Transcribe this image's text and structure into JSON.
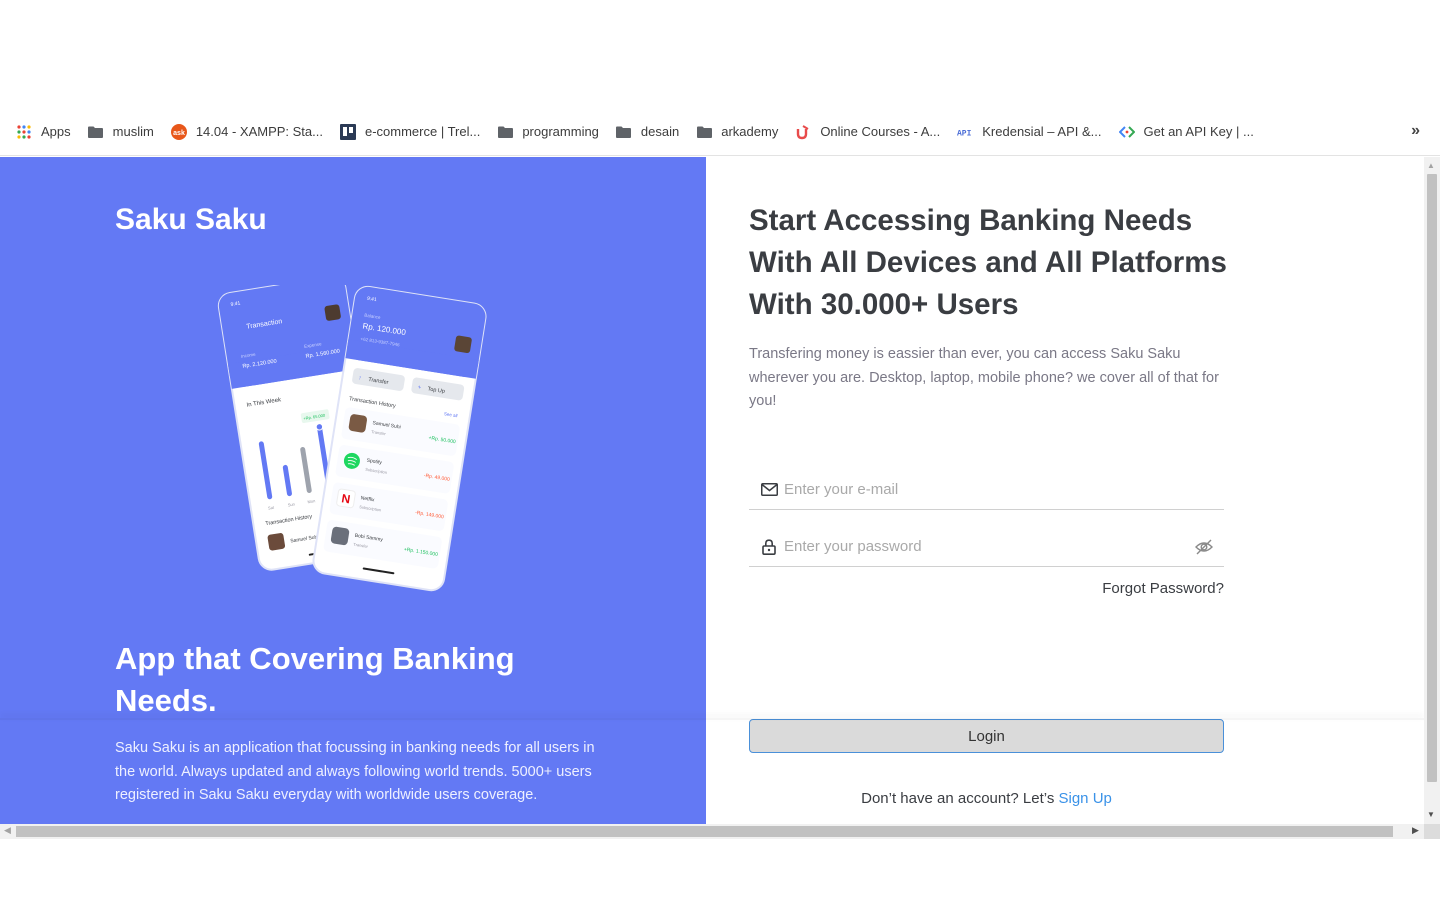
{
  "bookmarks": {
    "items": [
      {
        "label": "Apps",
        "icon": "apps-grid-icon"
      },
      {
        "label": "muslim",
        "icon": "folder-icon"
      },
      {
        "label": "14.04 - XAMPP: Sta...",
        "icon": "ask-icon"
      },
      {
        "label": "e-commerce | Trel...",
        "icon": "trello-icon"
      },
      {
        "label": "programming",
        "icon": "folder-icon"
      },
      {
        "label": "desain",
        "icon": "folder-icon"
      },
      {
        "label": "arkademy",
        "icon": "folder-icon"
      },
      {
        "label": "Online Courses - A...",
        "icon": "udemy-icon"
      },
      {
        "label": "Kredensial – API &...",
        "icon": "api-icon"
      },
      {
        "label": "Get an API Key | ...",
        "icon": "google-dev-icon"
      }
    ],
    "more": "»"
  },
  "left": {
    "brand": "Saku Saku",
    "heading": "App that Covering Banking Needs.",
    "description": "Saku Saku is an application that focussing in banking needs for all users in the world. Always updated and always following world trends. 5000+ users registered in Saku Saku everyday with worldwide users coverage."
  },
  "phone_back": {
    "title": "Transaction",
    "income_label": "Income",
    "income_value": "Rp. 2.120.000",
    "expense_label": "Expense",
    "expense_value": "Rp. 1.560.000",
    "week_label": "In This Week",
    "bar_badge": "+Rp. 65.000",
    "bar_levels": [
      0.78,
      0.42,
      0.62,
      0.85,
      0.55
    ],
    "days": [
      "Sat",
      "Sun",
      "Mon",
      "Tue"
    ],
    "history_label": "Transaction History",
    "contact": "Samuel Suhi"
  },
  "phone_front": {
    "balance_label": "Balance",
    "balance": "Rp. 120.000",
    "phone": "+62 813-9387-7946",
    "transfer_label": "Transfer",
    "topup_label": "Top Up",
    "history_label": "Transaction History",
    "see_all": "See all",
    "transactions": [
      {
        "name": "Samuel Suhi",
        "type": "Transfer",
        "amount": "+Rp. 50.000"
      },
      {
        "name": "Spotify",
        "type": "Subscription",
        "amount": "-Rp. 49.000"
      },
      {
        "name": "Netflix",
        "type": "Subscription",
        "amount": "-Rp. 149.000"
      },
      {
        "name": "Bobi Sammy",
        "type": "Transfer",
        "amount": "+Rp. 1.150.000"
      }
    ]
  },
  "right": {
    "heading": "Start Accessing Banking Needs With All Devices and All Platforms With 30.000+ Users",
    "description": "Transfering money is eassier than ever, you can access Saku Saku wherever you are. Desktop, laptop, mobile phone? we cover all of that for you!",
    "email_placeholder": "Enter your e-mail",
    "password_placeholder": "Enter your password",
    "forgot": "Forgot Password?",
    "login_label": "Login",
    "signup_prompt": "Don’t have an account? Let’s",
    "signup_link": "Sign Up"
  },
  "colors": {
    "primary": "#6379f4",
    "income": "#1ec15f",
    "expense": "#ff5b37",
    "link": "#3a92e8"
  }
}
